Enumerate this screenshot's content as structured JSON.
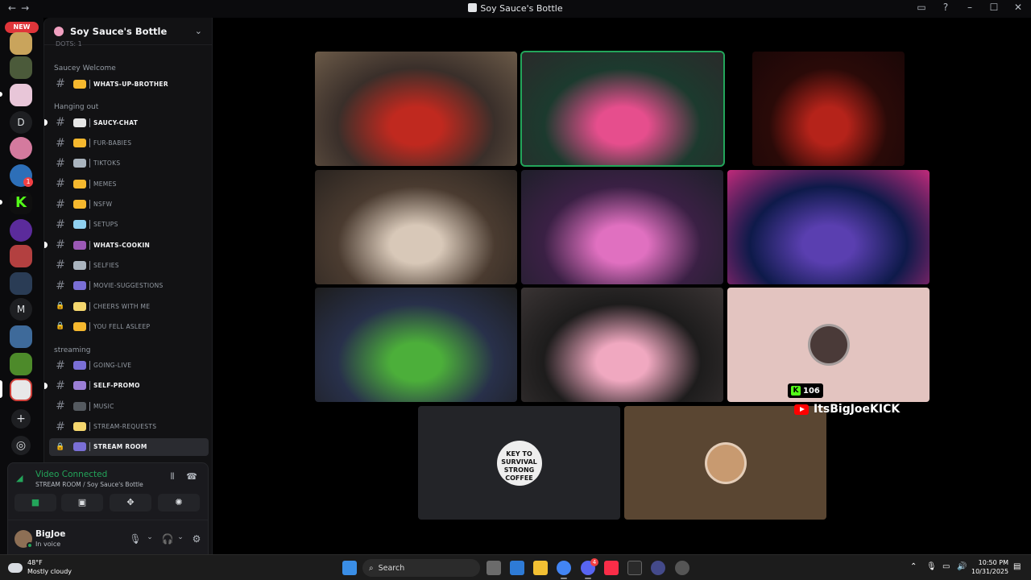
{
  "window": {
    "title": "Soy Sauce's Bottle"
  },
  "rail": {
    "new_label": "NEW",
    "letter_servers": [
      "D",
      "M"
    ],
    "mention_badge": "1"
  },
  "guild": {
    "name": "Soy Sauce's Bottle",
    "truncated_item": "DOTS: 1"
  },
  "categories": [
    {
      "name": "Saucey Welcome",
      "channels": [
        {
          "label": "WHATS-UP-BROTHER",
          "emoji_color": "#f5b82e",
          "bold": true,
          "locked": false
        }
      ]
    },
    {
      "name": "Hanging out",
      "channels": [
        {
          "label": "SAUCY-CHAT",
          "emoji_color": "#e6e6e6",
          "bold": true,
          "locked": false,
          "unread": true
        },
        {
          "label": "FUR-BABIES",
          "emoji_color": "#f5b82e",
          "bold": false,
          "locked": false
        },
        {
          "label": "TIKTOKS",
          "emoji_color": "#aab4be",
          "bold": false,
          "locked": false
        },
        {
          "label": "MEMES",
          "emoji_color": "#f5b82e",
          "bold": false,
          "locked": false
        },
        {
          "label": "NSFW",
          "emoji_color": "#f5b82e",
          "bold": false,
          "locked": false
        },
        {
          "label": "SETUPS",
          "emoji_color": "#8fd0f0",
          "bold": false,
          "locked": false
        },
        {
          "label": "WHATS-COOKIN",
          "emoji_color": "#9b59b6",
          "bold": true,
          "locked": false,
          "unread": true
        },
        {
          "label": "SELFIES",
          "emoji_color": "#aab4be",
          "bold": false,
          "locked": false
        },
        {
          "label": "MOVIE-SUGGESTIONS",
          "emoji_color": "#7a6fd6",
          "bold": false,
          "locked": false
        },
        {
          "label": "CHEERS WITH ME",
          "emoji_color": "#f5d76e",
          "bold": false,
          "locked": true
        },
        {
          "label": "YOU FELL ASLEEP",
          "emoji_color": "#f5b82e",
          "bold": false,
          "locked": true
        }
      ]
    },
    {
      "name": "streaming",
      "channels": [
        {
          "label": "GOING-LIVE",
          "emoji_color": "#7a6fd6",
          "bold": false,
          "locked": false
        },
        {
          "label": "SELF-PROMO",
          "emoji_color": "#9b7fd6",
          "bold": true,
          "locked": false,
          "unread": true
        },
        {
          "label": "MUSIC",
          "emoji_color": "#555a60",
          "bold": false,
          "locked": false
        },
        {
          "label": "STREAM-REQUESTS",
          "emoji_color": "#f5d76e",
          "bold": false,
          "locked": false
        },
        {
          "label": "STREAM ROOM",
          "emoji_color": "#7a6fd6",
          "bold": true,
          "locked": true,
          "active": true
        }
      ]
    }
  ],
  "voice": {
    "status": "Video Connected",
    "location": "STREAM ROOM / Soy Sauce's Bottle"
  },
  "user": {
    "name": "BigJoe",
    "status": "In voice"
  },
  "stage": {
    "tiles": [
      {
        "kind": "video",
        "colors": [
          "#3a2f2a",
          "#c0291f",
          "#6b5a48"
        ],
        "speaking": false
      },
      {
        "kind": "video",
        "colors": [
          "#1c3a2e",
          "#e64e8d",
          "#2a2a2a"
        ],
        "speaking": true
      },
      {
        "kind": "video",
        "colors": [
          "#2a0a08",
          "#b5231a",
          "#1a0707"
        ],
        "speaking": false
      },
      {
        "kind": "video",
        "colors": [
          "#4a3b30",
          "#d8c8b8",
          "#2a2420"
        ],
        "speaking": false
      },
      {
        "kind": "video",
        "colors": [
          "#3a2044",
          "#e070c0",
          "#1f1f2a"
        ],
        "speaking": false
      },
      {
        "kind": "video",
        "colors": [
          "#0e1a4a",
          "#5a3fb0",
          "#c02a7a"
        ],
        "speaking": false
      },
      {
        "kind": "video",
        "colors": [
          "#28304a",
          "#4caf3a",
          "#1d1d1d"
        ],
        "speaking": false
      },
      {
        "kind": "video",
        "colors": [
          "#1d1c1c",
          "#f0a8c0",
          "#3a3434"
        ],
        "speaking": false
      },
      {
        "kind": "avatar",
        "bg": "#e3c4c0",
        "avatar_color": "#4a3a38",
        "speaking": false
      },
      {
        "kind": "logo",
        "bg": "#232428",
        "logo_lines": [
          "KEY TO",
          "SURVIVAL",
          "STRONG",
          "COFFEE"
        ],
        "speaking": false
      },
      {
        "kind": "avatar",
        "bg": "#5a4632",
        "avatar_color": "#c89a70",
        "speaking": false
      }
    ],
    "kick_count": "106",
    "youtube_handle": "ItsBigJoeKICK"
  },
  "taskbar": {
    "temperature": "48°F",
    "weather": "Mostly cloudy",
    "search_placeholder": "Search",
    "time": "10:50 PM",
    "date": "10/31/2025",
    "discord_badge": "4"
  },
  "colors": {
    "accent_green": "#23a55a",
    "kick_green": "#53fc18",
    "youtube_red": "#ff0000"
  }
}
